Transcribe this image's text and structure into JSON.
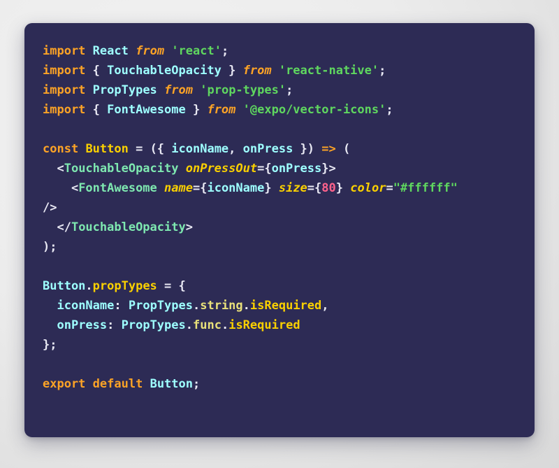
{
  "window": {
    "background_color": "#ececec",
    "card_background": "#2d2b55"
  },
  "editor": {
    "language": "jsx",
    "theme_colors": {
      "background": "#2d2b55",
      "keyword": "#fca326",
      "identifier": "#9effff",
      "string": "#5fd75f",
      "jsx_tag": "#7ee8b0",
      "declaration": "#fad000",
      "attribute": "#fad000",
      "property": "#e8e07a",
      "number": "#ff628c",
      "punctuation": "#e9e9f4"
    },
    "plain_text": "import React from 'react';\nimport { TouchableOpacity } from 'react-native';\nimport PropTypes from 'prop-types';\nimport { FontAwesome } from '@expo/vector-icons';\n\nconst Button = ({ iconName, onPress }) => (\n  <TouchableOpacity onPressOut={onPress}>\n    <FontAwesome name={iconName} size={80} color=\"#ffffff\" />\n  </TouchableOpacity>\n);\n\nButton.propTypes = {\n  iconName: PropTypes.string.isRequired,\n  onPress: PropTypes.func.isRequired\n};\n\nexport default Button;",
    "lines": [
      {
        "id": "line-1",
        "tokens": [
          {
            "text": "import",
            "cls": "t-kw"
          },
          {
            "text": " ",
            "cls": "t-pun"
          },
          {
            "text": "React",
            "cls": "t-id"
          },
          {
            "text": " ",
            "cls": "t-pun"
          },
          {
            "text": "from",
            "cls": "t-kw t-ital"
          },
          {
            "text": " ",
            "cls": "t-pun"
          },
          {
            "text": "'react'",
            "cls": "t-str"
          },
          {
            "text": ";",
            "cls": "t-pun"
          }
        ]
      },
      {
        "id": "line-2",
        "tokens": [
          {
            "text": "import",
            "cls": "t-kw"
          },
          {
            "text": " { ",
            "cls": "t-pun"
          },
          {
            "text": "TouchableOpacity",
            "cls": "t-id"
          },
          {
            "text": " } ",
            "cls": "t-pun"
          },
          {
            "text": "from",
            "cls": "t-kw t-ital"
          },
          {
            "text": " ",
            "cls": "t-pun"
          },
          {
            "text": "'react-native'",
            "cls": "t-str"
          },
          {
            "text": ";",
            "cls": "t-pun"
          }
        ]
      },
      {
        "id": "line-3",
        "tokens": [
          {
            "text": "import",
            "cls": "t-kw"
          },
          {
            "text": " ",
            "cls": "t-pun"
          },
          {
            "text": "PropTypes",
            "cls": "t-id"
          },
          {
            "text": " ",
            "cls": "t-pun"
          },
          {
            "text": "from",
            "cls": "t-kw t-ital"
          },
          {
            "text": " ",
            "cls": "t-pun"
          },
          {
            "text": "'prop-types'",
            "cls": "t-str"
          },
          {
            "text": ";",
            "cls": "t-pun"
          }
        ]
      },
      {
        "id": "line-4",
        "tokens": [
          {
            "text": "import",
            "cls": "t-kw"
          },
          {
            "text": " { ",
            "cls": "t-pun"
          },
          {
            "text": "FontAwesome",
            "cls": "t-id"
          },
          {
            "text": " } ",
            "cls": "t-pun"
          },
          {
            "text": "from",
            "cls": "t-kw t-ital"
          },
          {
            "text": " ",
            "cls": "t-pun"
          },
          {
            "text": "'@expo/vector-icons'",
            "cls": "t-str"
          },
          {
            "text": ";",
            "cls": "t-pun"
          }
        ]
      },
      {
        "id": "line-5",
        "tokens": []
      },
      {
        "id": "line-6",
        "tokens": [
          {
            "text": "const",
            "cls": "t-kw"
          },
          {
            "text": " ",
            "cls": "t-pun"
          },
          {
            "text": "Button",
            "cls": "t-decl"
          },
          {
            "text": " = ({ ",
            "cls": "t-pun"
          },
          {
            "text": "iconName",
            "cls": "t-id"
          },
          {
            "text": ", ",
            "cls": "t-pun"
          },
          {
            "text": "onPress",
            "cls": "t-id"
          },
          {
            "text": " }) ",
            "cls": "t-pun"
          },
          {
            "text": "=>",
            "cls": "t-kw"
          },
          {
            "text": " (",
            "cls": "t-pun"
          }
        ]
      },
      {
        "id": "line-7",
        "tokens": [
          {
            "text": "  <",
            "cls": "t-pun"
          },
          {
            "text": "TouchableOpacity",
            "cls": "t-tag"
          },
          {
            "text": " ",
            "cls": "t-pun"
          },
          {
            "text": "onPressOut",
            "cls": "t-attr"
          },
          {
            "text": "={",
            "cls": "t-pun"
          },
          {
            "text": "onPress",
            "cls": "t-id"
          },
          {
            "text": "}>",
            "cls": "t-pun"
          }
        ]
      },
      {
        "id": "line-8",
        "tokens": [
          {
            "text": "    <",
            "cls": "t-pun"
          },
          {
            "text": "FontAwesome",
            "cls": "t-tag"
          },
          {
            "text": " ",
            "cls": "t-pun"
          },
          {
            "text": "name",
            "cls": "t-attr"
          },
          {
            "text": "={",
            "cls": "t-pun"
          },
          {
            "text": "iconName",
            "cls": "t-id"
          },
          {
            "text": "} ",
            "cls": "t-pun"
          },
          {
            "text": "size",
            "cls": "t-attr"
          },
          {
            "text": "={",
            "cls": "t-pun"
          },
          {
            "text": "80",
            "cls": "t-num"
          },
          {
            "text": "} ",
            "cls": "t-pun"
          },
          {
            "text": "color",
            "cls": "t-attr"
          },
          {
            "text": "=",
            "cls": "t-pun"
          },
          {
            "text": "\"#ffffff\"",
            "cls": "t-str"
          }
        ]
      },
      {
        "id": "line-8-wrap",
        "tokens": [
          {
            "text": "/>",
            "cls": "t-pun"
          }
        ]
      },
      {
        "id": "line-9",
        "tokens": [
          {
            "text": "  </",
            "cls": "t-pun"
          },
          {
            "text": "TouchableOpacity",
            "cls": "t-tag"
          },
          {
            "text": ">",
            "cls": "t-pun"
          }
        ]
      },
      {
        "id": "line-10",
        "tokens": [
          {
            "text": ");",
            "cls": "t-pun"
          }
        ]
      },
      {
        "id": "line-11",
        "tokens": []
      },
      {
        "id": "line-12",
        "tokens": [
          {
            "text": "Button",
            "cls": "t-id"
          },
          {
            "text": ".",
            "cls": "t-pun"
          },
          {
            "text": "propTypes",
            "cls": "t-decl"
          },
          {
            "text": " = {",
            "cls": "t-pun"
          }
        ]
      },
      {
        "id": "line-13",
        "tokens": [
          {
            "text": "  ",
            "cls": "t-pun"
          },
          {
            "text": "iconName",
            "cls": "t-id"
          },
          {
            "text": ": ",
            "cls": "t-pun"
          },
          {
            "text": "PropTypes",
            "cls": "t-id"
          },
          {
            "text": ".",
            "cls": "t-pun"
          },
          {
            "text": "string",
            "cls": "t-prop"
          },
          {
            "text": ".",
            "cls": "t-pun"
          },
          {
            "text": "isRequired",
            "cls": "t-decl"
          },
          {
            "text": ",",
            "cls": "t-pun"
          }
        ]
      },
      {
        "id": "line-14",
        "tokens": [
          {
            "text": "  ",
            "cls": "t-pun"
          },
          {
            "text": "onPress",
            "cls": "t-id"
          },
          {
            "text": ": ",
            "cls": "t-pun"
          },
          {
            "text": "PropTypes",
            "cls": "t-id"
          },
          {
            "text": ".",
            "cls": "t-pun"
          },
          {
            "text": "func",
            "cls": "t-prop"
          },
          {
            "text": ".",
            "cls": "t-pun"
          },
          {
            "text": "isRequired",
            "cls": "t-decl"
          }
        ]
      },
      {
        "id": "line-15",
        "tokens": [
          {
            "text": "};",
            "cls": "t-pun"
          }
        ]
      },
      {
        "id": "line-16",
        "tokens": []
      },
      {
        "id": "line-17",
        "tokens": [
          {
            "text": "export",
            "cls": "t-kw"
          },
          {
            "text": " ",
            "cls": "t-pun"
          },
          {
            "text": "default",
            "cls": "t-kw"
          },
          {
            "text": " ",
            "cls": "t-pun"
          },
          {
            "text": "Button",
            "cls": "t-id"
          },
          {
            "text": ";",
            "cls": "t-pun"
          }
        ]
      }
    ]
  }
}
